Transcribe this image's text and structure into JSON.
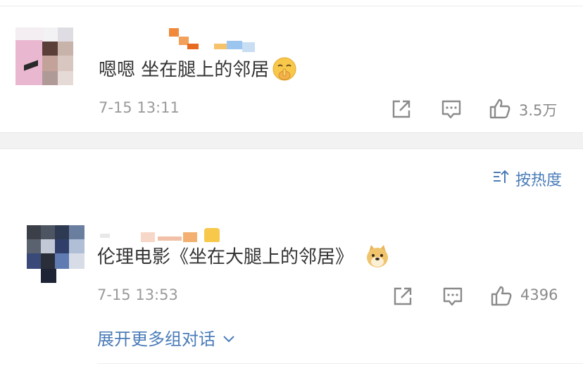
{
  "comments": [
    {
      "text": "嗯嗯 坐在腿上的邻居",
      "emoji": "shushing-face-emoji",
      "time": "7-15 13:11",
      "likes": "3.5万"
    },
    {
      "text": "伦理电影《坐在大腿上的邻居》",
      "emoji": "doge-emoji",
      "time": "7-15 13:53",
      "likes": "4396"
    }
  ],
  "sort": {
    "label": "按热度",
    "icon": "sort-icon"
  },
  "expand": {
    "label": "展开更多组对话",
    "icon": "chevron-down-icon"
  },
  "icons": {
    "share": "share-icon",
    "reply": "comment-icon",
    "like": "thumbs-up-icon"
  },
  "colors": {
    "link": "#4a7cb8",
    "meta": "#9a9a9a",
    "text": "#333333",
    "icon": "#8a8a8a"
  }
}
